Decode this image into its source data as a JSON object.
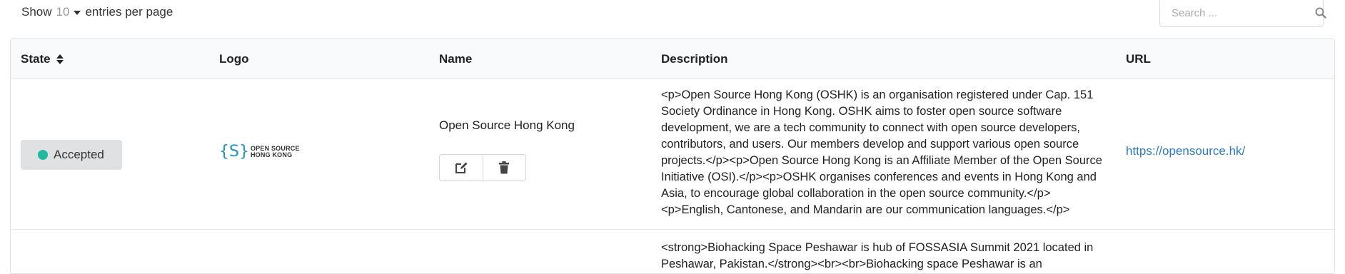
{
  "controls": {
    "show_label": "Show",
    "per_page_value": "10",
    "entries_label": "entries per page",
    "search_placeholder": "Search ..."
  },
  "table": {
    "headers": {
      "state": "State",
      "logo": "Logo",
      "name": "Name",
      "description": "Description",
      "url": "URL"
    },
    "rows": [
      {
        "state": "Accepted",
        "logo_text_line1": "OPEN SOURCE",
        "logo_text_line2": "HONG KONG",
        "name": "Open Source Hong Kong",
        "description": "<p>Open Source Hong Kong (OSHK) is an organisation registered under Cap. 151 Society Ordinance in Hong Kong. OSHK aims to foster open source software development, we are a tech community to connect with open source developers, contributors, and users. Our members develop and support various open source projects.</p><p>Open Source Hong Kong is an Affiliate Member of the Open Source Initiative (OSI).</p><p>OSHK organises conferences and events in Hong Kong and Asia, to encourage global collaboration in the open source community.</p><p>English, Cantonese, and Mandarin are our communication languages.</p>",
        "url": "https://opensource.hk/"
      },
      {
        "description": "<strong>Biohacking Space Peshawar is hub of FOSSASIA Summit 2021 located in Peshawar, Pakistan.</strong><br><br>Biohacking space Peshawar is an"
      }
    ]
  },
  "colors": {
    "accepted_dot": "#21ba9f",
    "link": "#2b7bc0",
    "logo_accent": "#1f93c8"
  }
}
